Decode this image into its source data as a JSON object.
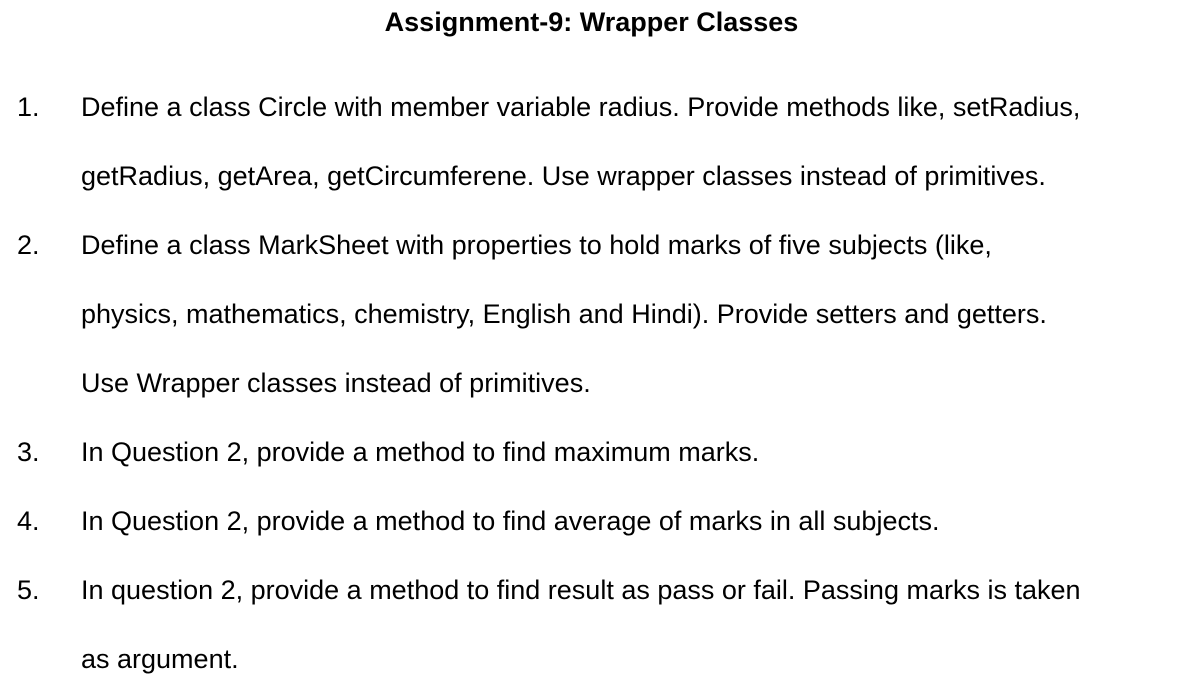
{
  "document": {
    "title": "Assignment-9: Wrapper Classes",
    "items": [
      {
        "number": "1.",
        "lines": [
          "Define a class Circle with member variable radius. Provide methods like, setRadius,",
          "getRadius, getArea, getCircumferene. Use wrapper classes instead of primitives."
        ]
      },
      {
        "number": "2.",
        "lines": [
          "Define a class MarkSheet with properties to hold marks of five subjects (like,",
          "physics, mathematics, chemistry, English and Hindi). Provide setters and getters.",
          "Use Wrapper classes instead of primitives."
        ]
      },
      {
        "number": "3.",
        "lines": [
          "In Question 2, provide a method to find maximum marks."
        ]
      },
      {
        "number": "4.",
        "lines": [
          "In Question 2, provide a method to find average of marks in all subjects."
        ]
      },
      {
        "number": "5.",
        "lines": [
          "In question 2, provide a method to find result as pass or fail. Passing marks is taken",
          "as argument."
        ]
      }
    ]
  }
}
